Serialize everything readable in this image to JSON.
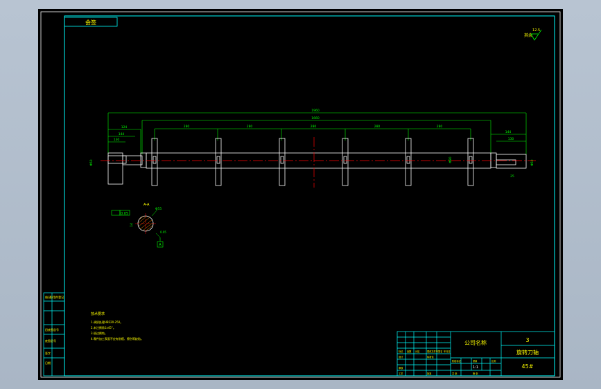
{
  "frame": {
    "zone_label": "会签"
  },
  "roughness": {
    "label": "其余",
    "value": "12.5"
  },
  "dims": {
    "overall": "1960",
    "between_ends": "1660",
    "left_outer": "124",
    "left_mid": "144",
    "left_inner": "130",
    "right_outer": "144",
    "right_inner": "130",
    "right_small": "25",
    "dia_left": "Φ50",
    "dia_right": "Φ50",
    "dia_body": "Φ80",
    "spacing": [
      "280",
      "280",
      "280",
      "280",
      "280"
    ]
  },
  "section": {
    "title": "A-A",
    "tolerance": "0.05",
    "dim_a": "14",
    "dim_b": "Φ55",
    "flag": "A"
  },
  "tech_req": {
    "title": "技术要求",
    "lines": [
      "1.调质处理HB220-250。",
      "2.未注倒角1x45°。",
      "3.锐边倒钝。",
      "4.零件加工表面不应有划痕、擦伤等缺陷。"
    ]
  },
  "left_table": [
    "借(通)用件登记",
    "旧底图总号",
    "底图总号",
    "签字",
    "日期"
  ],
  "title_block": {
    "company": "公司名称",
    "part_name": "旋转刀轴",
    "quantity": "3",
    "material": "45#",
    "scale": "1:1",
    "small_labels": [
      "标记",
      "处数",
      "分区",
      "更改文件号",
      "签名",
      "年月日",
      "设计",
      "标准化",
      "阶段标记",
      "重量",
      "比例",
      "审核",
      "工艺",
      "批准",
      "共 张",
      "第 张"
    ]
  },
  "colors": {
    "background": "#000000",
    "frame": "#00ffff",
    "outline": "#ffffff",
    "dimension": "#00ff00",
    "centerline": "#ff0000",
    "text": "#ffff00"
  }
}
